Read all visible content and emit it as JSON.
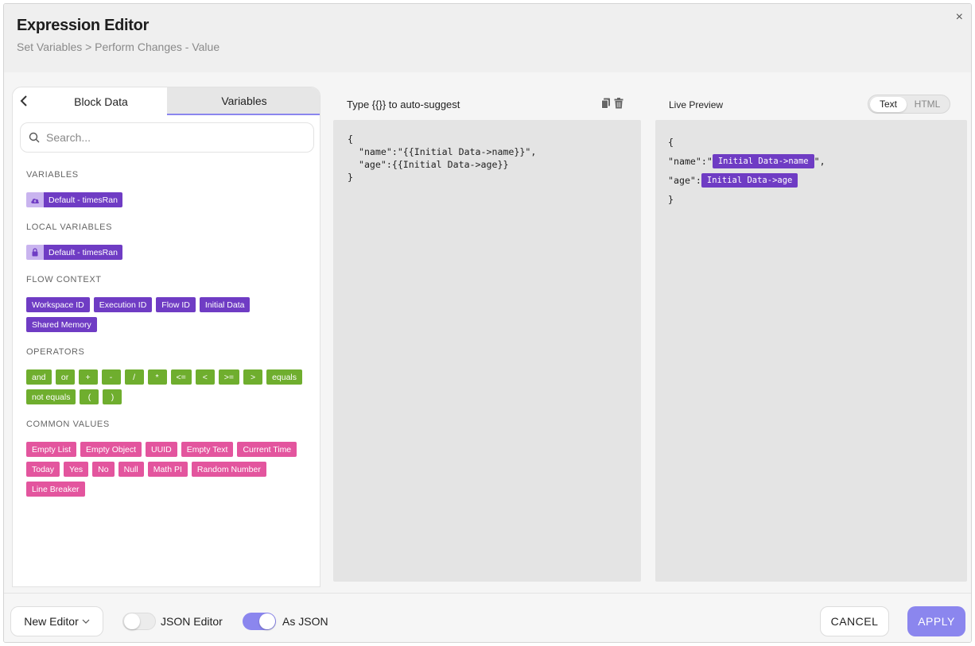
{
  "header": {
    "title": "Expression Editor",
    "breadcrumb": "Set Variables > Perform Changes - Value",
    "close_icon": "×"
  },
  "left_panel": {
    "back_icon": "‹",
    "tabs": [
      {
        "label": "Block Data",
        "active": false
      },
      {
        "label": "Variables",
        "active": true
      }
    ],
    "search": {
      "placeholder": "Search...",
      "value": ""
    },
    "sections": {
      "variables": {
        "label": "VARIABLES",
        "items": [
          {
            "label": "Default - timesRan",
            "icon": "cloud-icon"
          }
        ]
      },
      "local_variables": {
        "label": "LOCAL VARIABLES",
        "items": [
          {
            "label": "Default - timesRan",
            "icon": "lock-icon"
          }
        ]
      },
      "flow_context": {
        "label": "FLOW CONTEXT",
        "items": [
          "Workspace ID",
          "Execution ID",
          "Flow ID",
          "Initial Data",
          "Shared Memory"
        ]
      },
      "operators": {
        "label": "OPERATORS",
        "items": [
          "and",
          "or",
          "+",
          "-",
          "/",
          "*",
          "<=",
          "<",
          ">=",
          ">",
          "equals",
          "not equals",
          "(",
          ")"
        ]
      },
      "common_values": {
        "label": "COMMON VALUES",
        "items": [
          "Empty List",
          "Empty Object",
          "UUID",
          "Empty Text",
          "Current Time",
          "Today",
          "Yes",
          "No",
          "Null",
          "Math PI",
          "Random Number",
          "Line Breaker"
        ]
      }
    }
  },
  "editor": {
    "hint": "Type {{}} to auto-suggest",
    "content": "{\n  \"name\":\"{{Initial Data->name}}\",\n  \"age\":{{Initial Data->age}}\n}"
  },
  "preview": {
    "label": "Live Preview",
    "mode_options": [
      "Text",
      "HTML"
    ],
    "selected_mode": "Text",
    "lines": {
      "open": "{",
      "name_key": "\"name\":\"",
      "name_tag": "Initial Data->name",
      "name_suffix": "\",",
      "age_key": "\"age\":",
      "age_tag": "Initial Data->age",
      "close": "}"
    }
  },
  "footer": {
    "new_editor_label": "New Editor",
    "json_editor_label": "JSON Editor",
    "json_editor_on": false,
    "as_json_label": "As JSON",
    "as_json_on": true,
    "cancel_label": "CANCEL",
    "apply_label": "APPLY"
  },
  "colors": {
    "purple_chip": "#6f3cc4",
    "green_chip": "#6fae2e",
    "pink_chip": "#e3559e",
    "accent": "#8b86ee"
  }
}
